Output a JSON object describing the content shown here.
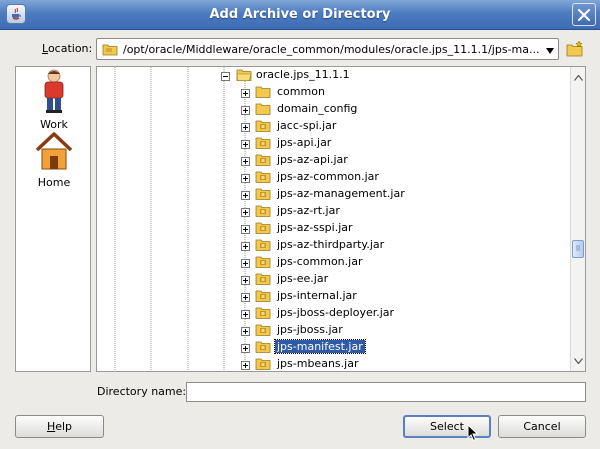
{
  "window": {
    "title": "Add Archive or Directory"
  },
  "location": {
    "label_prefix": "",
    "label_mnemonic": "L",
    "label_rest": "ocation:",
    "path": "/opt/oracle/Middleware/oracle_common/modules/oracle.jps_11.1.1/jps-ma..."
  },
  "shortcuts": [
    {
      "label": "Work",
      "icon": "work-person-icon"
    },
    {
      "label": "Home",
      "icon": "home-house-icon"
    }
  ],
  "tree": {
    "parent": {
      "name": "oracle.jps_11.1.1",
      "expanded": true
    },
    "items": [
      {
        "name": "common",
        "type": "folder"
      },
      {
        "name": "domain_config",
        "type": "folder"
      },
      {
        "name": "jacc-spi.jar",
        "type": "jar"
      },
      {
        "name": "jps-api.jar",
        "type": "jar"
      },
      {
        "name": "jps-az-api.jar",
        "type": "jar"
      },
      {
        "name": "jps-az-common.jar",
        "type": "jar"
      },
      {
        "name": "jps-az-management.jar",
        "type": "jar"
      },
      {
        "name": "jps-az-rt.jar",
        "type": "jar"
      },
      {
        "name": "jps-az-sspi.jar",
        "type": "jar"
      },
      {
        "name": "jps-az-thirdparty.jar",
        "type": "jar"
      },
      {
        "name": "jps-common.jar",
        "type": "jar"
      },
      {
        "name": "jps-ee.jar",
        "type": "jar"
      },
      {
        "name": "jps-internal.jar",
        "type": "jar"
      },
      {
        "name": "jps-jboss-deployer.jar",
        "type": "jar"
      },
      {
        "name": "jps-jboss.jar",
        "type": "jar"
      },
      {
        "name": "jps-manifest.jar",
        "type": "jar",
        "selected": true
      },
      {
        "name": "jps-mbeans.jar",
        "type": "jar"
      }
    ]
  },
  "directory_name": {
    "label": "Directory name:",
    "value": ""
  },
  "buttons": {
    "help": {
      "mnemonic": "H",
      "rest": "elp"
    },
    "select": "Select",
    "cancel": "Cancel"
  },
  "colors": {
    "titlebar": "#4d7bc0",
    "selection": "#2e5aa6",
    "folder": "#f2c94c",
    "dialog_bg": "#ecebe8"
  }
}
